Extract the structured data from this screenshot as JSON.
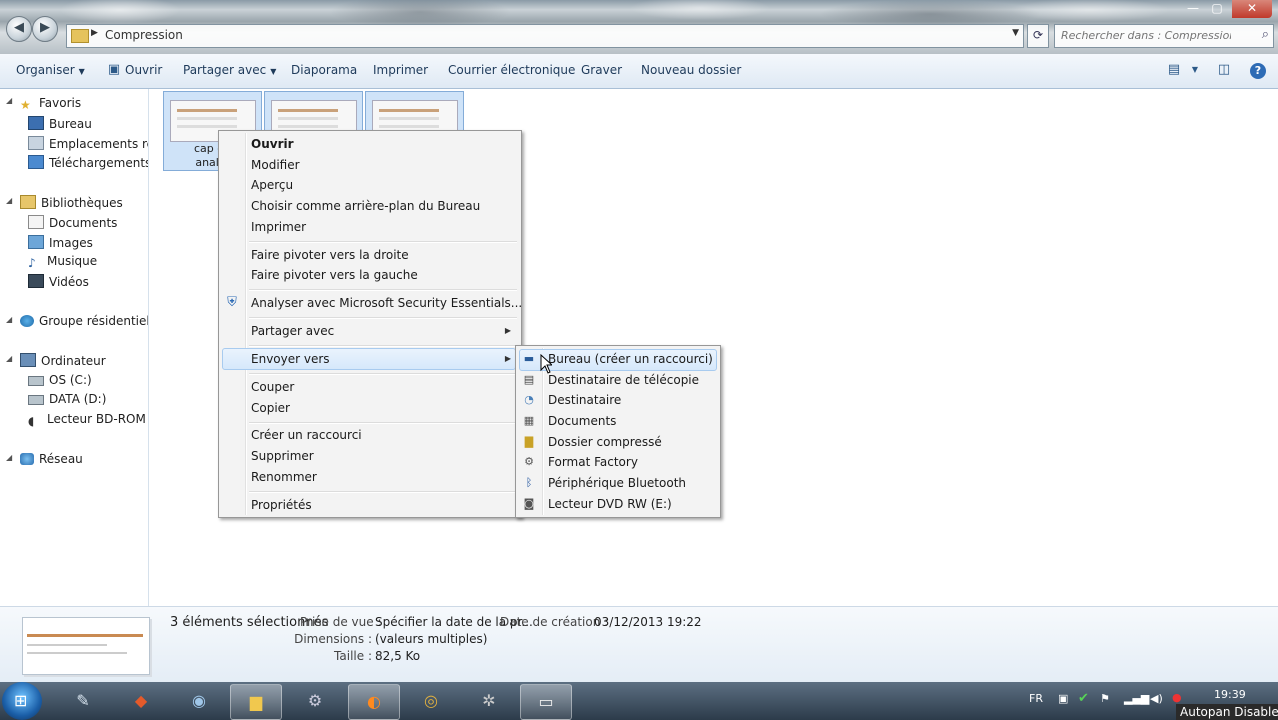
{
  "window": {
    "minimize": "—",
    "maximize": "▢",
    "close": "✕"
  },
  "address": {
    "path": "Compression",
    "refresh": "⟳",
    "search_placeholder": "Rechercher dans : Compression"
  },
  "toolbar": {
    "organiser": "Organiser",
    "ouvrir": "Ouvrir",
    "partager": "Partager avec",
    "diaporama": "Diaporama",
    "imprimer": "Imprimer",
    "courrier": "Courrier électronique",
    "graver": "Graver",
    "nouveau_dossier": "Nouveau dossier"
  },
  "nav": {
    "favoris": "Favoris",
    "bureau": "Bureau",
    "emplacements": "Emplacements récer",
    "telechargements": "Téléchargements",
    "bibliotheques": "Bibliothèques",
    "documents": "Documents",
    "images": "Images",
    "musique": "Musique",
    "videos": "Vidéos",
    "groupe": "Groupe résidentiel",
    "ordinateur": "Ordinateur",
    "os": "OS (C:)",
    "data": "DATA (D:)",
    "bdrom": "Lecteur BD-ROM (G:",
    "reseau": "Réseau"
  },
  "files": [
    {
      "caption_line1": "cap go",
      "caption_line2": "analyt"
    }
  ],
  "context_menu": {
    "ouvrir": "Ouvrir",
    "modifier": "Modifier",
    "apercu": "Aperçu",
    "arriere_plan": "Choisir comme arrière-plan du Bureau",
    "imprimer": "Imprimer",
    "pivoter_droite": "Faire pivoter vers la droite",
    "pivoter_gauche": "Faire pivoter vers la gauche",
    "analyser": "Analyser avec Microsoft Security Essentials...",
    "partager": "Partager avec",
    "envoyer": "Envoyer vers",
    "couper": "Couper",
    "copier": "Copier",
    "raccourci": "Créer un raccourci",
    "supprimer": "Supprimer",
    "renommer": "Renommer",
    "proprietes": "Propriétés"
  },
  "submenu": [
    {
      "label": "Bureau (créer un raccourci)",
      "icon": "desktop-icon"
    },
    {
      "label": "Destinataire de télécopie",
      "icon": "fax-icon"
    },
    {
      "label": "Destinataire",
      "icon": "mail-icon"
    },
    {
      "label": "Documents",
      "icon": "document-icon"
    },
    {
      "label": "Dossier compressé",
      "icon": "zip-folder-icon"
    },
    {
      "label": "Format Factory",
      "icon": "gear-icon"
    },
    {
      "label": "Périphérique Bluetooth",
      "icon": "bluetooth-icon"
    },
    {
      "label": "Lecteur DVD RW (E:)",
      "icon": "dvd-drive-icon"
    }
  ],
  "details": {
    "selected": "3 éléments sélectionnés",
    "prise_label": "Prise de vue :",
    "prise_value": "Spécifier la date de la pr...",
    "creation_label": "Date de création :",
    "creation_value": "03/12/2013 19:22",
    "dimensions_label": "Dimensions :",
    "dimensions_value": "(valeurs multiples)",
    "taille_label": "Taille :",
    "taille_value": "82,5 Ko"
  },
  "taskbar": {
    "lang": "FR",
    "clock": "19:39",
    "autopan": "Autopan Disabled"
  }
}
